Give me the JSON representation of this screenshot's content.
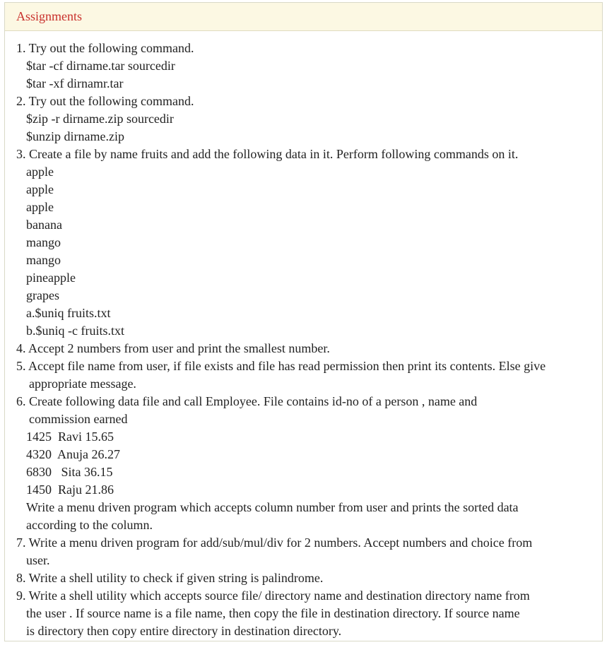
{
  "panel": {
    "title": "Assignments"
  },
  "lines": [
    {
      "text": "1. Try out the following command.",
      "indent": 0
    },
    {
      "text": "$tar -cf dirname.tar sourcedir",
      "indent": 1
    },
    {
      "text": "$tar -xf dirnamr.tar",
      "indent": 1
    },
    {
      "text": "2. Try out the following command.",
      "indent": 0
    },
    {
      "text": "$zip -r dirname.zip sourcedir",
      "indent": 1
    },
    {
      "text": "$unzip dirname.zip",
      "indent": 1
    },
    {
      "text": "3. Create a file by name fruits and add the following data in it. Perform following commands on it.",
      "indent": 0
    },
    {
      "text": "apple",
      "indent": 1
    },
    {
      "text": "apple",
      "indent": 1
    },
    {
      "text": "apple",
      "indent": 1
    },
    {
      "text": "banana",
      "indent": 1
    },
    {
      "text": "mango",
      "indent": 1
    },
    {
      "text": "mango",
      "indent": 1
    },
    {
      "text": "pineapple",
      "indent": 1
    },
    {
      "text": "grapes",
      "indent": 1
    },
    {
      "text": "a.$uniq fruits.txt",
      "indent": 1
    },
    {
      "text": "b.$uniq -c fruits.txt",
      "indent": 1
    },
    {
      "text": "4. Accept 2 numbers from user and print the smallest number.",
      "indent": 0
    },
    {
      "text": "5. Accept file name from user, if file exists and file has read permission then print its contents. Else give",
      "indent": 0
    },
    {
      "text": "appropriate message.",
      "indent": 2
    },
    {
      "text": "6. Create following data file and call Employee. File contains id-no of a person , name and",
      "indent": 0
    },
    {
      "text": "commission earned",
      "indent": 2
    },
    {
      "text": "1425  Ravi 15.65",
      "indent": 1
    },
    {
      "text": "4320  Anuja 26.27",
      "indent": 1
    },
    {
      "text": "6830   Sita 36.15",
      "indent": 1
    },
    {
      "text": "1450  Raju 21.86",
      "indent": 1
    },
    {
      "text": "Write a menu driven program which accepts column number from user and prints the sorted data",
      "indent": 1
    },
    {
      "text": "according to the column.",
      "indent": 1
    },
    {
      "text": "7. Write a menu driven program for add/sub/mul/div for 2 numbers. Accept numbers and choice from",
      "indent": 0
    },
    {
      "text": "user.",
      "indent": 1
    },
    {
      "text": "8. Write a shell utility to check if given string is palindrome.",
      "indent": 0
    },
    {
      "text": "9. Write a shell utility which accepts source file/ directory name and destination directory name from",
      "indent": 0
    },
    {
      "text": "the user . If source name is a file name, then copy the file in destination directory. If source name",
      "indent": 1
    },
    {
      "text": "is directory then copy entire directory in destination directory.",
      "indent": 1
    }
  ]
}
